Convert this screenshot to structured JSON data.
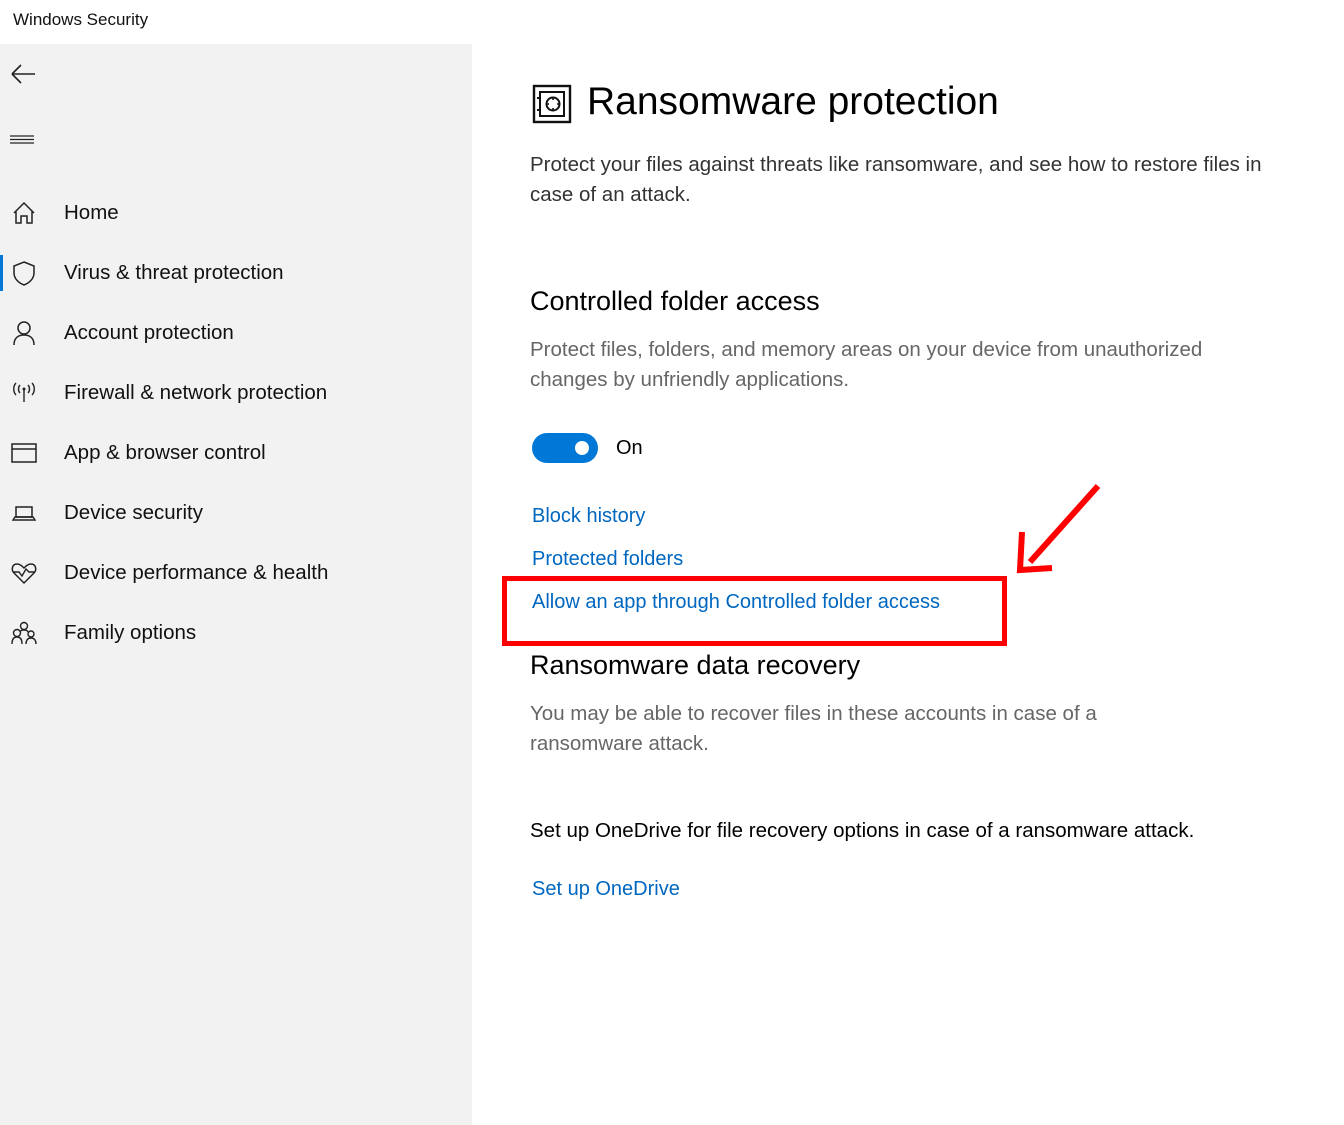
{
  "window": {
    "title": "Windows Security"
  },
  "sidebar": {
    "back_icon": "back-arrow-icon",
    "menu_icon": "hamburger-menu-icon",
    "items": [
      {
        "label": "Home",
        "icon": "home-icon",
        "selected": false
      },
      {
        "label": "Virus & threat protection",
        "icon": "shield-icon",
        "selected": true
      },
      {
        "label": "Account protection",
        "icon": "person-icon",
        "selected": false
      },
      {
        "label": "Firewall & network protection",
        "icon": "wireless-antenna-icon",
        "selected": false
      },
      {
        "label": "App & browser control",
        "icon": "browser-window-icon",
        "selected": false
      },
      {
        "label": "Device security",
        "icon": "laptop-icon",
        "selected": false
      },
      {
        "label": "Device performance & health",
        "icon": "heart-pulse-icon",
        "selected": false
      },
      {
        "label": "Family options",
        "icon": "family-icon",
        "selected": false
      }
    ],
    "accent_color": "#0078d7"
  },
  "main": {
    "page_icon": "safe-vault-icon",
    "title": "Ransomware protection",
    "description": "Protect your files against threats like ransomware, and see how to restore files in case of an attack.",
    "controlled_folder_access": {
      "heading": "Controlled folder access",
      "description": "Protect files, folders, and memory areas on your device from unauthorized changes by unfriendly applications.",
      "toggle_state": "On",
      "toggle_on": true,
      "links": [
        "Block history",
        "Protected folders",
        "Allow an app through Controlled folder access"
      ]
    },
    "data_recovery": {
      "heading": "Ransomware data recovery",
      "description": "You may be able to recover files in these accounts in case of a ransomware attack.",
      "onedrive_text": "Set up OneDrive for file recovery options in case of a ransomware attack.",
      "onedrive_link": "Set up OneDrive"
    }
  },
  "annotation": {
    "highlight_color": "#ff0000",
    "highlighted_item": "Allow an app through Controlled folder access"
  }
}
